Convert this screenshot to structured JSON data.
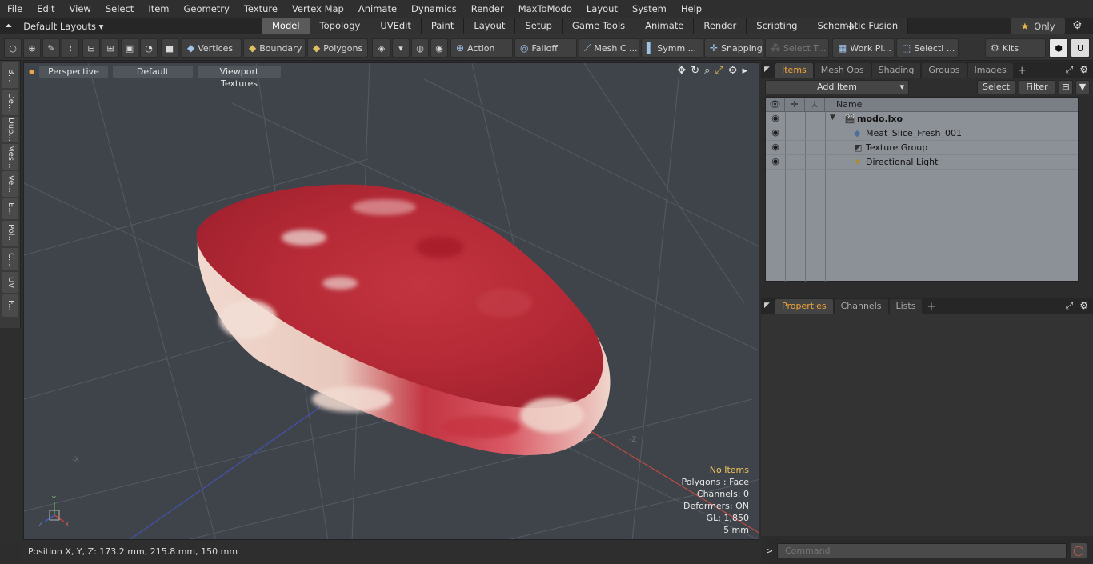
{
  "menu": [
    "File",
    "Edit",
    "View",
    "Select",
    "Item",
    "Geometry",
    "Texture",
    "Vertex Map",
    "Animate",
    "Dynamics",
    "Render",
    "MaxToModo",
    "Layout",
    "System",
    "Help"
  ],
  "layouts_label": "Default Layouts",
  "tabs": [
    "Model",
    "Topology",
    "UVEdit",
    "Paint",
    "Layout",
    "Setup",
    "Game Tools",
    "Animate",
    "Render",
    "Scripting",
    "Schematic Fusion"
  ],
  "only_label": "Only",
  "toolbar": {
    "vertices": "Vertices",
    "boundary": "Boundary",
    "polygons": "Polygons",
    "action": "Action",
    "falloff": "Falloff",
    "mesh": "Mesh C ...",
    "symmetry": "Symm ...",
    "snapping": "Snapping",
    "select_t": "Select T...",
    "work_plane": "Work Pl...",
    "selection": "Selecti ...",
    "kits": "Kits"
  },
  "left_tabs": [
    "B...",
    "De...",
    "Dup...",
    "Mes...",
    "Ve...",
    "E...",
    "Pol...",
    "C...",
    "UV",
    "F..."
  ],
  "viewport": {
    "view": "Perspective",
    "shading": "Default",
    "textures": "Viewport Textures",
    "info": {
      "no_items": "No Items",
      "polygons": "Polygons : Face",
      "channels": "Channels: 0",
      "deformers": "Deformers: ON",
      "gl": "GL: 1,850",
      "unit": "5 mm"
    }
  },
  "status": "Position X, Y, Z:   173.2 mm, 215.8 mm, 150 mm",
  "items_panel": {
    "tabs": [
      "Items",
      "Mesh Ops",
      "Shading",
      "Groups",
      "Images"
    ],
    "add_item": "Add Item",
    "select": "Select",
    "filter": "Filter",
    "name_col": "Name",
    "tree": [
      {
        "label": "modo.lxo",
        "icon": "scene-icon"
      },
      {
        "label": "Meat_Slice_Fresh_001",
        "icon": "mesh-icon"
      },
      {
        "label": "Texture Group",
        "icon": "texture-group-icon"
      },
      {
        "label": "Directional Light",
        "icon": "light-icon"
      }
    ]
  },
  "props_panel": {
    "tabs": [
      "Properties",
      "Channels",
      "Lists"
    ],
    "command_placeholder": "Command"
  },
  "colors": {
    "accent": "#f0a43a",
    "meat": "#c0323c",
    "viewport_bg": "#3f444b"
  }
}
